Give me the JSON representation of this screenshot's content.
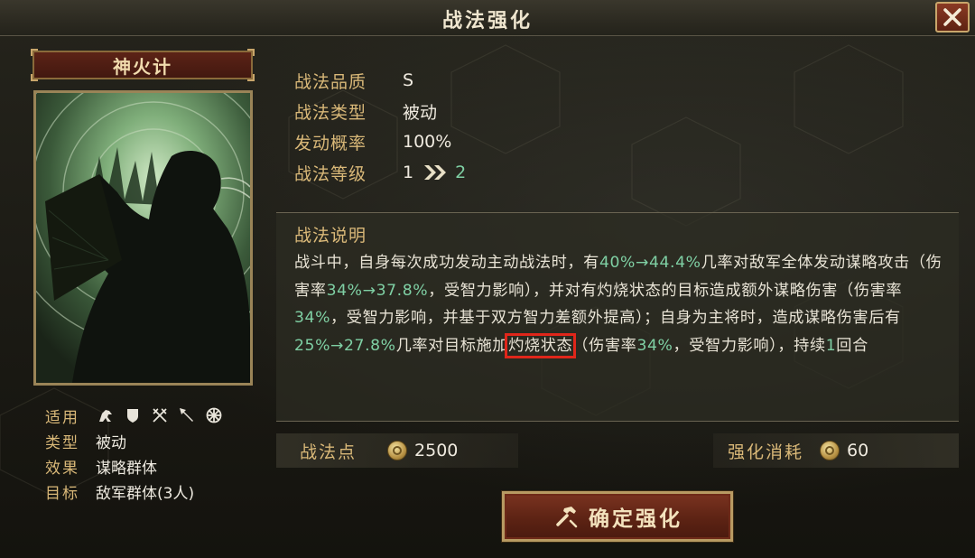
{
  "window": {
    "title": "战法强化",
    "close_icon": "close-x-icon"
  },
  "skill": {
    "name": "神火计",
    "art": "silhouette-strategist-with-fan-art"
  },
  "attributes": {
    "applicable_label": "适用",
    "applicable_units": [
      "cavalry-icon",
      "shield-icon",
      "crossed-bows-icon",
      "spear-icon",
      "siege-wheel-icon"
    ],
    "type_label": "类型",
    "type_value": "被动",
    "effect_label": "效果",
    "effect_value": "谋略群体",
    "target_label": "目标",
    "target_value": "敌军群体(3人)"
  },
  "stats": {
    "quality_label": "战法品质",
    "quality_value": "S",
    "type_label": "战法类型",
    "type_value": "被动",
    "rate_label": "发动概率",
    "rate_value": "100%",
    "level_label": "战法等级",
    "level_current": "1",
    "level_next": "2"
  },
  "description": {
    "title": "战法说明",
    "parts": {
      "p1": "战斗中，自身每次成功发动主动战法时，有",
      "v1": "40%→44.4%",
      "p2": "几率对敌军全体发动谋略攻击（伤害率",
      "v2": "34%→37.8%",
      "p3": "，受智力影响），并对有灼烧状态的目标造成额外谋略伤害（伤害率",
      "v3": "34%",
      "p4": "，受智力影响，并基于双方智力差额外提高）；自身为主将时，造成谋略伤害后有",
      "v4": "25%→27.8%",
      "p5": "几率对目标施加",
      "hl": "灼烧状态",
      "p6": "（伤害率",
      "v5": "34%",
      "p7": "，受智力影响），持续",
      "v6": "1",
      "p8": "回合"
    }
  },
  "points": {
    "label": "战法点",
    "value": "2500"
  },
  "cost": {
    "label": "强化消耗",
    "value": "60"
  },
  "confirm": {
    "label": "确定强化"
  },
  "colors": {
    "accent_gold": "#d9b878",
    "value_green": "#7fd0a4",
    "highlight_red": "#e0261a",
    "button_red": "#5d2314"
  }
}
